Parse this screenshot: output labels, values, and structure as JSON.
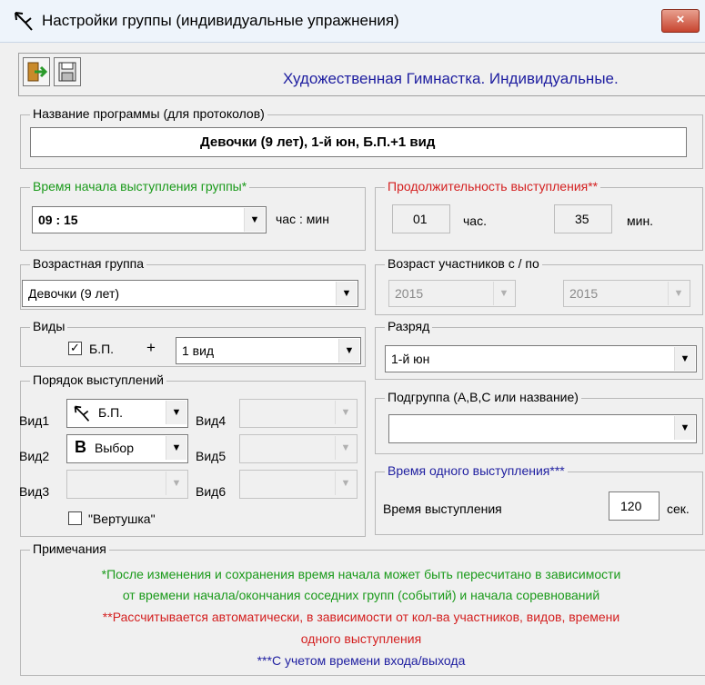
{
  "window": {
    "title": "Настройки группы (индивидуальные упражнения)",
    "close_label": "×"
  },
  "toolbar": {
    "exit_icon": "exit-door-icon",
    "save_icon": "floppy-disk-icon",
    "sport_title": "Художественная Гимнастка. Индивидуальные."
  },
  "program": {
    "legend": "Название программы (для протоколов)",
    "value": "Девочки (9 лет), 1-й юн, Б.П.+1 вид"
  },
  "start_time": {
    "legend": "Время начала выступления группы*",
    "value": "09 : 15",
    "unit_label": "час : мин"
  },
  "duration": {
    "legend": "Продолжительность выступления**",
    "hours": "01",
    "hours_label": "час.",
    "minutes": "35",
    "minutes_label": "мин."
  },
  "age_group": {
    "legend": "Возрастная группа",
    "value": "Девочки (9 лет)"
  },
  "age_range": {
    "legend": "Возраст участников с / по",
    "from": "2015",
    "to": "2015"
  },
  "types": {
    "legend": "Виды",
    "checkbox_label": "Б.П.",
    "checked_mark": "✓",
    "plus": "+",
    "value": "1 вид"
  },
  "rank": {
    "legend": "Разряд",
    "value": "1-й юн"
  },
  "order": {
    "legend": "Порядок выступлений",
    "slots": [
      {
        "label": "Вид1",
        "glyph": "",
        "value": "Б.П.",
        "enabled": true
      },
      {
        "label": "Вид2",
        "glyph": "B",
        "value": "Выбор",
        "enabled": true
      },
      {
        "label": "Вид3",
        "glyph": "",
        "value": "",
        "enabled": false
      },
      {
        "label": "Вид4",
        "glyph": "",
        "value": "",
        "enabled": false
      },
      {
        "label": "Вид5",
        "glyph": "",
        "value": "",
        "enabled": false
      },
      {
        "label": "Вид6",
        "glyph": "",
        "value": "",
        "enabled": false
      }
    ],
    "spinner_label": "\"Вертушка\""
  },
  "subgroup": {
    "legend": "Подгруппа (А,В,С или название)",
    "value": ""
  },
  "performance": {
    "legend": "Время одного выступления***",
    "label": "Время выступления",
    "value": "120",
    "unit": "сек."
  },
  "notes": {
    "legend": "Примечания",
    "line1": "*После изменения и сохранения время начала может быть пересчитано в зависимости",
    "line2": "от времени начала/окончания соседних групп (событий) и начала соревнований",
    "line3": "**Рассчитывается автоматически, в зависимости от кол-ва участников, видов, времени",
    "line4": "одного выступления",
    "line5": "***С учетом времени входа/выхода"
  },
  "colors": {
    "green": "#1a9a1a",
    "red": "#d42020",
    "blue": "#1e1ea0"
  }
}
